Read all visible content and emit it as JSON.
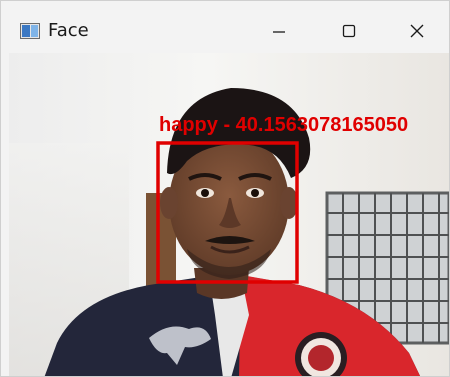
{
  "window": {
    "title": "Face",
    "controls": {
      "minimize_icon": "minimize-icon",
      "maximize_icon": "maximize-icon",
      "close_icon": "close-icon"
    }
  },
  "detection": {
    "label": "happy - 40.1563078165050",
    "box_color": "#e00000"
  }
}
